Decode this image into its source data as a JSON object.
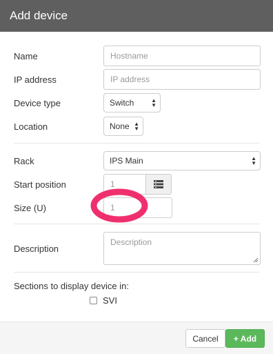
{
  "header": {
    "title": "Add device"
  },
  "form": {
    "name": {
      "label": "Name",
      "placeholder": "Hostname"
    },
    "ip": {
      "label": "IP address",
      "placeholder": "IP address"
    },
    "device_type": {
      "label": "Device type",
      "value": "Switch"
    },
    "location": {
      "label": "Location",
      "value": "None"
    },
    "rack": {
      "label": "Rack",
      "value": "IPS Main"
    },
    "start_position": {
      "label": "Start position",
      "placeholder": "1",
      "button_icon": "list-icon"
    },
    "size": {
      "label": "Size (U)",
      "placeholder": "1",
      "annotation_color": "#f0306e"
    },
    "description": {
      "label": "Description",
      "placeholder": "Description"
    },
    "sections": {
      "label": "Sections to display device in:",
      "checkbox_label": "SVI",
      "checked": false
    }
  },
  "footer": {
    "cancel_label": "Cancel",
    "add_label": "+ Add",
    "add_color": "#5cb85c"
  }
}
